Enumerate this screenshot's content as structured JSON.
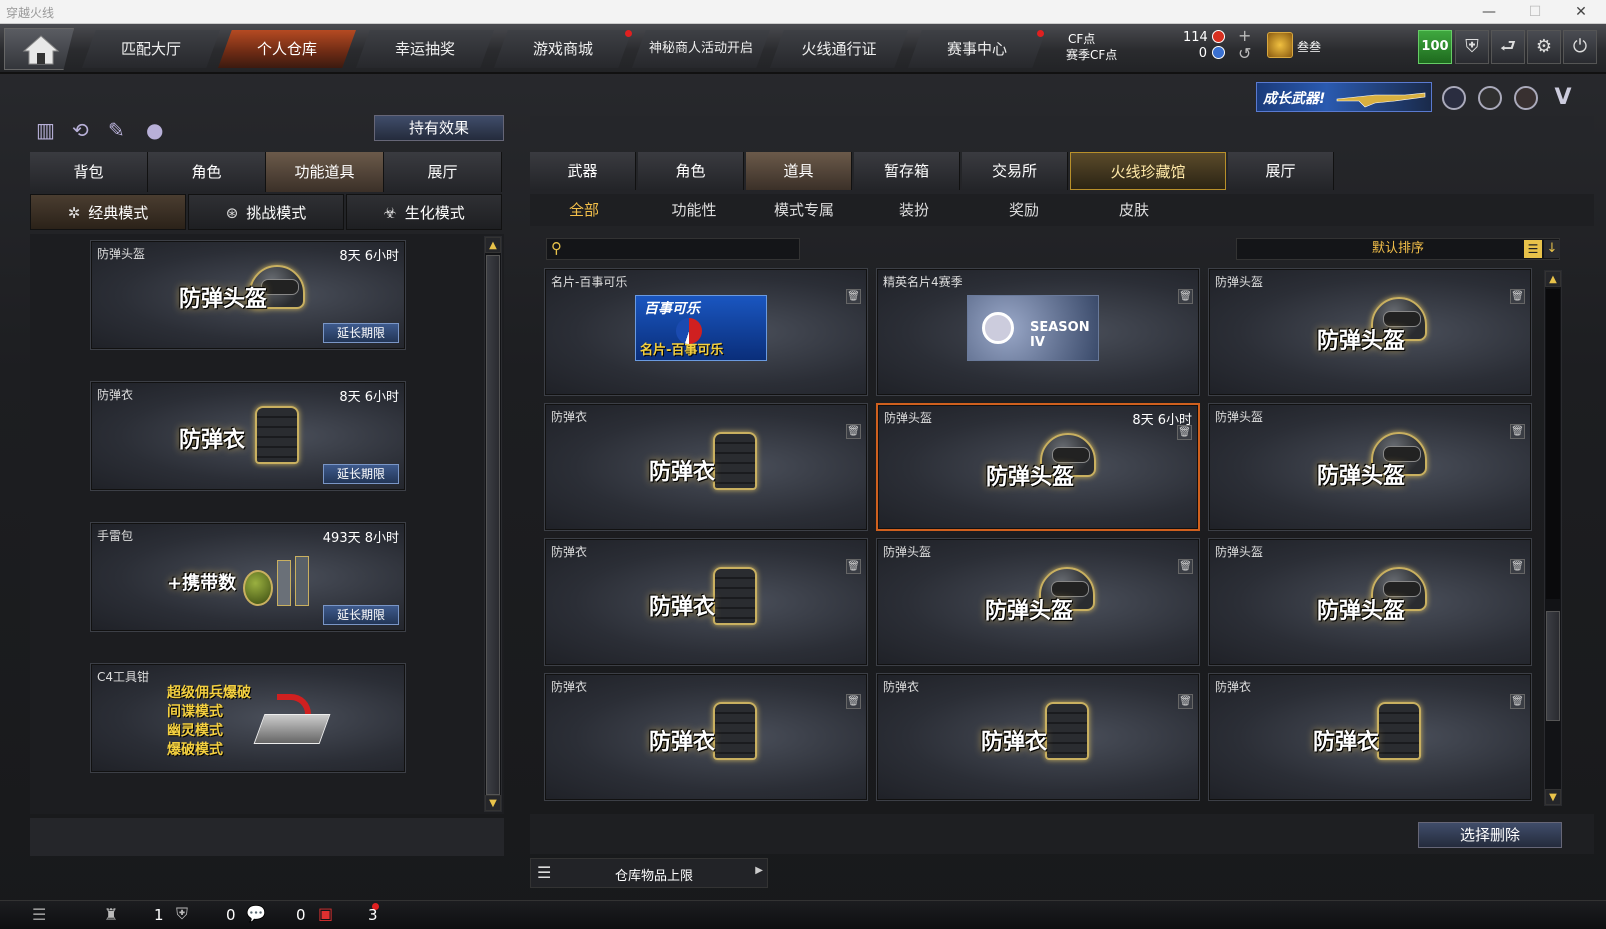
{
  "window": {
    "title": "穿越火线",
    "minimize": "—",
    "maximize": "☐",
    "close": "✕"
  },
  "nav": {
    "tabs": [
      {
        "label": "匹配大厅",
        "active": false
      },
      {
        "label": "个人仓库",
        "active": true
      },
      {
        "label": "幸运抽奖",
        "active": false
      },
      {
        "label": "游戏商城",
        "active": false
      },
      {
        "label": "神秘商人活动开启",
        "active": false
      },
      {
        "label": "火线通行证",
        "active": false
      },
      {
        "label": "赛事中心",
        "active": false
      }
    ],
    "cf_label": "CF点",
    "cf_value": "114",
    "season_cf_label": "赛季CF点",
    "season_cf_value": "0",
    "plus": "+",
    "refresh": "↺",
    "user": "叁叁",
    "level": "100",
    "buttons": [
      "shield-icon",
      "return-icon",
      "gear-icon",
      "power-icon"
    ]
  },
  "banner": {
    "text": "成长武器!"
  },
  "left": {
    "effect_button": "持有效果",
    "tabs": [
      {
        "label": "背包",
        "active": false
      },
      {
        "label": "角色",
        "active": false
      },
      {
        "label": "功能道具",
        "active": true
      },
      {
        "label": "展厅",
        "active": false
      }
    ],
    "modes": [
      {
        "label": "经典模式",
        "icon": "✲",
        "active": true
      },
      {
        "label": "挑战模式",
        "icon": "⊛",
        "active": false
      },
      {
        "label": "生化模式",
        "icon": "☣",
        "active": false
      }
    ],
    "items": [
      {
        "name": "防弹头盔",
        "time": "8天 6小时",
        "big": "防弹头盔",
        "kind": "helmet",
        "ext": "延长期限"
      },
      {
        "name": "防弹衣",
        "time": "8天 6小时",
        "big": "防弹衣",
        "kind": "vest",
        "ext": "延长期限"
      },
      {
        "name": "手雷包",
        "time": "493天 8小时",
        "big": "+携带数",
        "kind": "grenade",
        "ext": "延长期限"
      },
      {
        "name": "C4工具钳",
        "time": "",
        "big": "",
        "kind": "c4",
        "ext": "",
        "lines": [
          "超级佣兵爆破",
          "间谍模式",
          "幽灵模式",
          "爆破模式"
        ]
      }
    ]
  },
  "right": {
    "tabs": [
      {
        "label": "武器",
        "state": ""
      },
      {
        "label": "角色",
        "state": ""
      },
      {
        "label": "道具",
        "state": "active"
      },
      {
        "label": "暂存箱",
        "state": ""
      },
      {
        "label": "交易所",
        "state": ""
      },
      {
        "label": "火线珍藏馆",
        "state": "hl"
      },
      {
        "label": "展厅",
        "state": ""
      }
    ],
    "categories": [
      {
        "label": "全部",
        "active": true
      },
      {
        "label": "功能性",
        "active": false
      },
      {
        "label": "模式专属",
        "active": false
      },
      {
        "label": "装扮",
        "active": false
      },
      {
        "label": "奖励",
        "active": false
      },
      {
        "label": "皮肤",
        "active": false
      }
    ],
    "search_placeholder": "",
    "sort_label": "默认排序",
    "grid": [
      {
        "name": "名片-百事可乐",
        "time": "",
        "big": "",
        "kind": "pepsi",
        "img_top": "百事可乐",
        "img_bottom": "名片-百事可乐"
      },
      {
        "name": "精英名片4赛季",
        "time": "",
        "big": "",
        "kind": "season",
        "img_top": "SEASON IV",
        "img_bottom": ""
      },
      {
        "name": "防弹头盔",
        "time": "",
        "big": "防弹头盔",
        "kind": "helmet"
      },
      {
        "name": "防弹衣",
        "time": "",
        "big": "防弹衣",
        "kind": "vest"
      },
      {
        "name": "防弹头盔",
        "time": "8天 6小时",
        "big": "防弹头盔",
        "kind": "helmet",
        "selected": true
      },
      {
        "name": "防弹头盔",
        "time": "",
        "big": "防弹头盔",
        "kind": "helmet"
      },
      {
        "name": "防弹衣",
        "time": "",
        "big": "防弹衣",
        "kind": "vest"
      },
      {
        "name": "防弹头盔",
        "time": "",
        "big": "防弹头盔",
        "kind": "helmet"
      },
      {
        "name": "防弹头盔",
        "time": "",
        "big": "防弹头盔",
        "kind": "helmet"
      },
      {
        "name": "防弹衣",
        "time": "",
        "big": "防弹衣",
        "kind": "vest"
      },
      {
        "name": "防弹衣",
        "time": "",
        "big": "防弹衣",
        "kind": "vest"
      },
      {
        "name": "防弹衣",
        "time": "",
        "big": "防弹衣",
        "kind": "vest"
      }
    ],
    "delete_button": "选择删除",
    "capacity_label": "仓库物品上限"
  },
  "status": {
    "count1": "1",
    "count2": "0",
    "count3": "0",
    "count4": "3"
  },
  "colors": {
    "accent": "#f4c04a",
    "active_tab": "#b54a22",
    "selected_border": "#d0601e"
  }
}
